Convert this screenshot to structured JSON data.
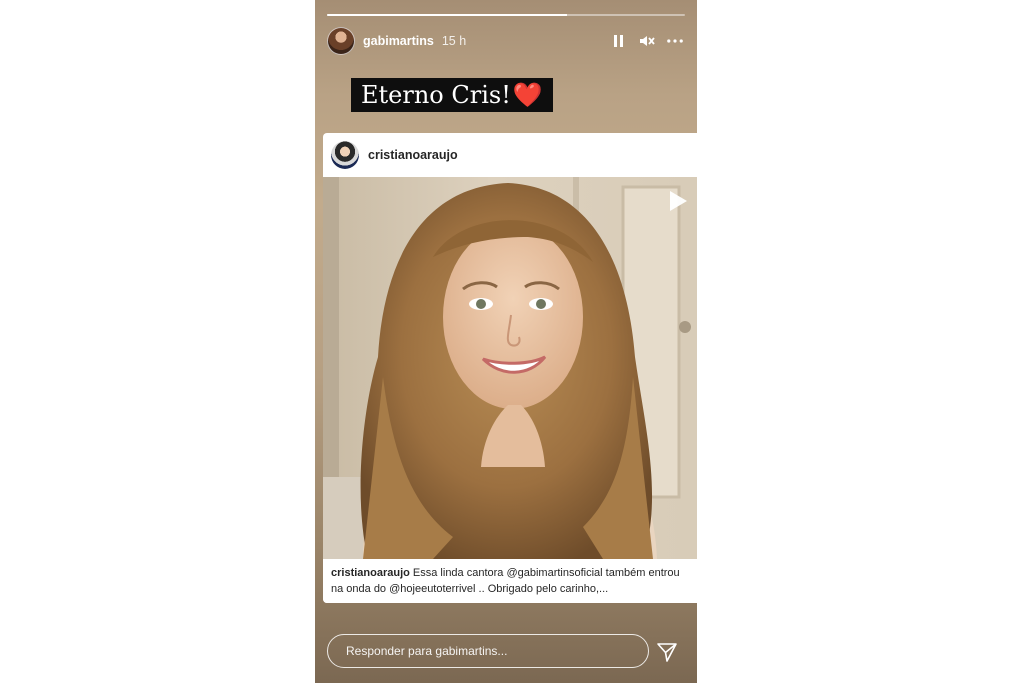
{
  "story": {
    "progress_segments": 2,
    "active_progress": 0.67,
    "username": "gabimartins",
    "time": "15 h",
    "icons": {
      "pause": "pause-icon",
      "mute": "mute-icon",
      "more": "more-icon"
    }
  },
  "caption": {
    "text": "Eterno Cris!",
    "emoji": "❤️"
  },
  "post": {
    "username": "cristianoaraujo",
    "caption_user": "cristianoaraujo",
    "caption_text": " Essa linda cantora @gabimartinsoficial também entrou na onda do @hojeeutoterrivel .. Obrigado pelo carinho,...",
    "play_icon": "play-icon"
  },
  "reply": {
    "placeholder": "Responder para gabimartins...",
    "send_icon": "send-icon"
  },
  "colors": {
    "story_bg_top": "#a58e74",
    "story_bg_bottom": "#7b6852",
    "heart": "#e0202e"
  }
}
